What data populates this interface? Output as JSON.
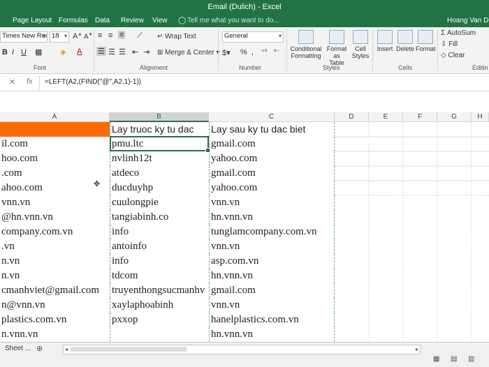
{
  "title_bar": {
    "title": "Email (Dulich) - Excel"
  },
  "ribbon_tabs": [
    "Page Layout",
    "Formulas",
    "Data",
    "Review",
    "View"
  ],
  "tell_me": "Tell me what you want to do...",
  "user": "Hoang Van Dung",
  "ribbon": {
    "font_name": "Times New Roma",
    "font_size": "18",
    "wrap_text": "Wrap Text",
    "merge_center": "Merge & Center",
    "number_format": "General",
    "conditional_formatting": [
      "Conditional",
      "Formatting"
    ],
    "format_as_table": [
      "Format as",
      "Table"
    ],
    "cell_styles": [
      "Cell",
      "Styles"
    ],
    "insert": "Insert",
    "delete": "Delete",
    "format": "Format",
    "autosum": "AutoSum",
    "fill": "Fill",
    "clear": "Clear",
    "groups": {
      "font": "Font",
      "alignment": "Alignment",
      "number": "Number",
      "styles": "Styles",
      "cells": "Cells",
      "editing": "Editin"
    }
  },
  "formula_bar": {
    "fx": "fx",
    "formula": "=LEFT(A2,(FIND(\"@\",A2,1)-1))"
  },
  "columns": [
    "A",
    "B",
    "C",
    "D",
    "E",
    "F",
    "G",
    "H"
  ],
  "rows": [
    [
      "",
      "Lay truoc ky tu dac",
      "Lay sau ky tu dac biet"
    ],
    [
      "il.com",
      "pmu.ltc",
      "gmail.com"
    ],
    [
      "hoo.com",
      "nvlinh12t",
      "yahoo.com"
    ],
    [
      ".com",
      "atdeco",
      "gmail.com"
    ],
    [
      "ahoo.com",
      "ducduyhp",
      "yahoo.com"
    ],
    [
      "vnn.vn",
      "cuulongpie",
      "vnn.vn"
    ],
    [
      "@hn.vnn.vn",
      "tangiabinh.co",
      "hn.vnn.vn"
    ],
    [
      "company.com.vn",
      "info",
      "tunglamcompany.com.vn"
    ],
    [
      ".vn",
      "antoinfo",
      "vnn.vn"
    ],
    [
      "n.vn",
      "info",
      "asp.com.vn"
    ],
    [
      "n.vn",
      "tdcom",
      "hn.vnn.vn"
    ],
    [
      "cmanhviet@gmail.com",
      "truyenthongsucmanhv",
      "gmail.com"
    ],
    [
      "n@vnn.vn",
      "xaylaphoabinh",
      "vnn.vn"
    ],
    [
      "plastics.com.vn",
      "pxxop",
      "hanelplastics.com.vn"
    ],
    [
      "n.vnn.vn",
      "",
      "hn.vnn.vn"
    ]
  ],
  "sheet_tab": "Sheet ..."
}
